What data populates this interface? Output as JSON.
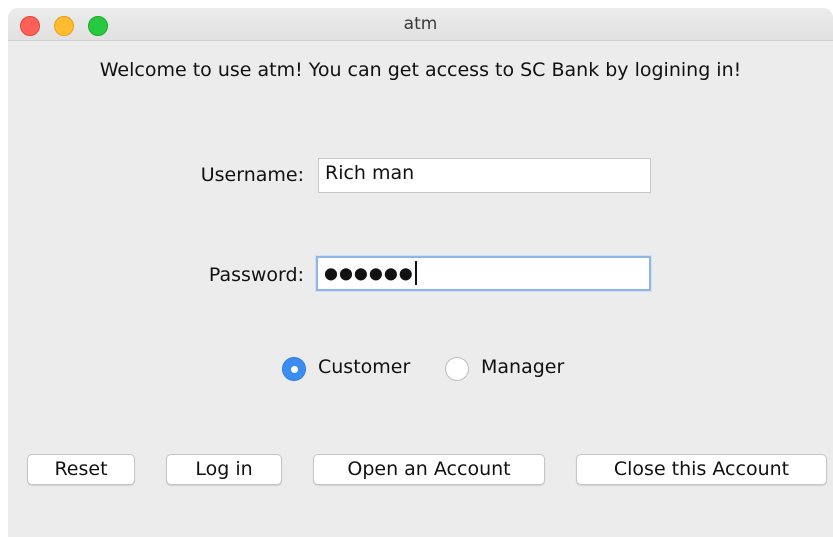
{
  "window": {
    "title": "atm"
  },
  "welcome_text": "Welcome to use atm! You can get access to SC Bank by logining in!",
  "form": {
    "username_label": "Username:",
    "username_value": "Rich man",
    "password_label": "Password:",
    "password_masked": "●●●●●●"
  },
  "role": {
    "options": [
      "Customer",
      "Manager"
    ],
    "selected": "Customer"
  },
  "buttons": {
    "reset": "Reset",
    "login": "Log in",
    "open_account": "Open an Account",
    "close_account": "Close this Account"
  },
  "colors": {
    "radio_selected": "#3b8ef0",
    "focus_ring": "#8fb6e6",
    "traffic_close": "#fe5f57",
    "traffic_minimize": "#febc2e",
    "traffic_zoom": "#28c840"
  }
}
